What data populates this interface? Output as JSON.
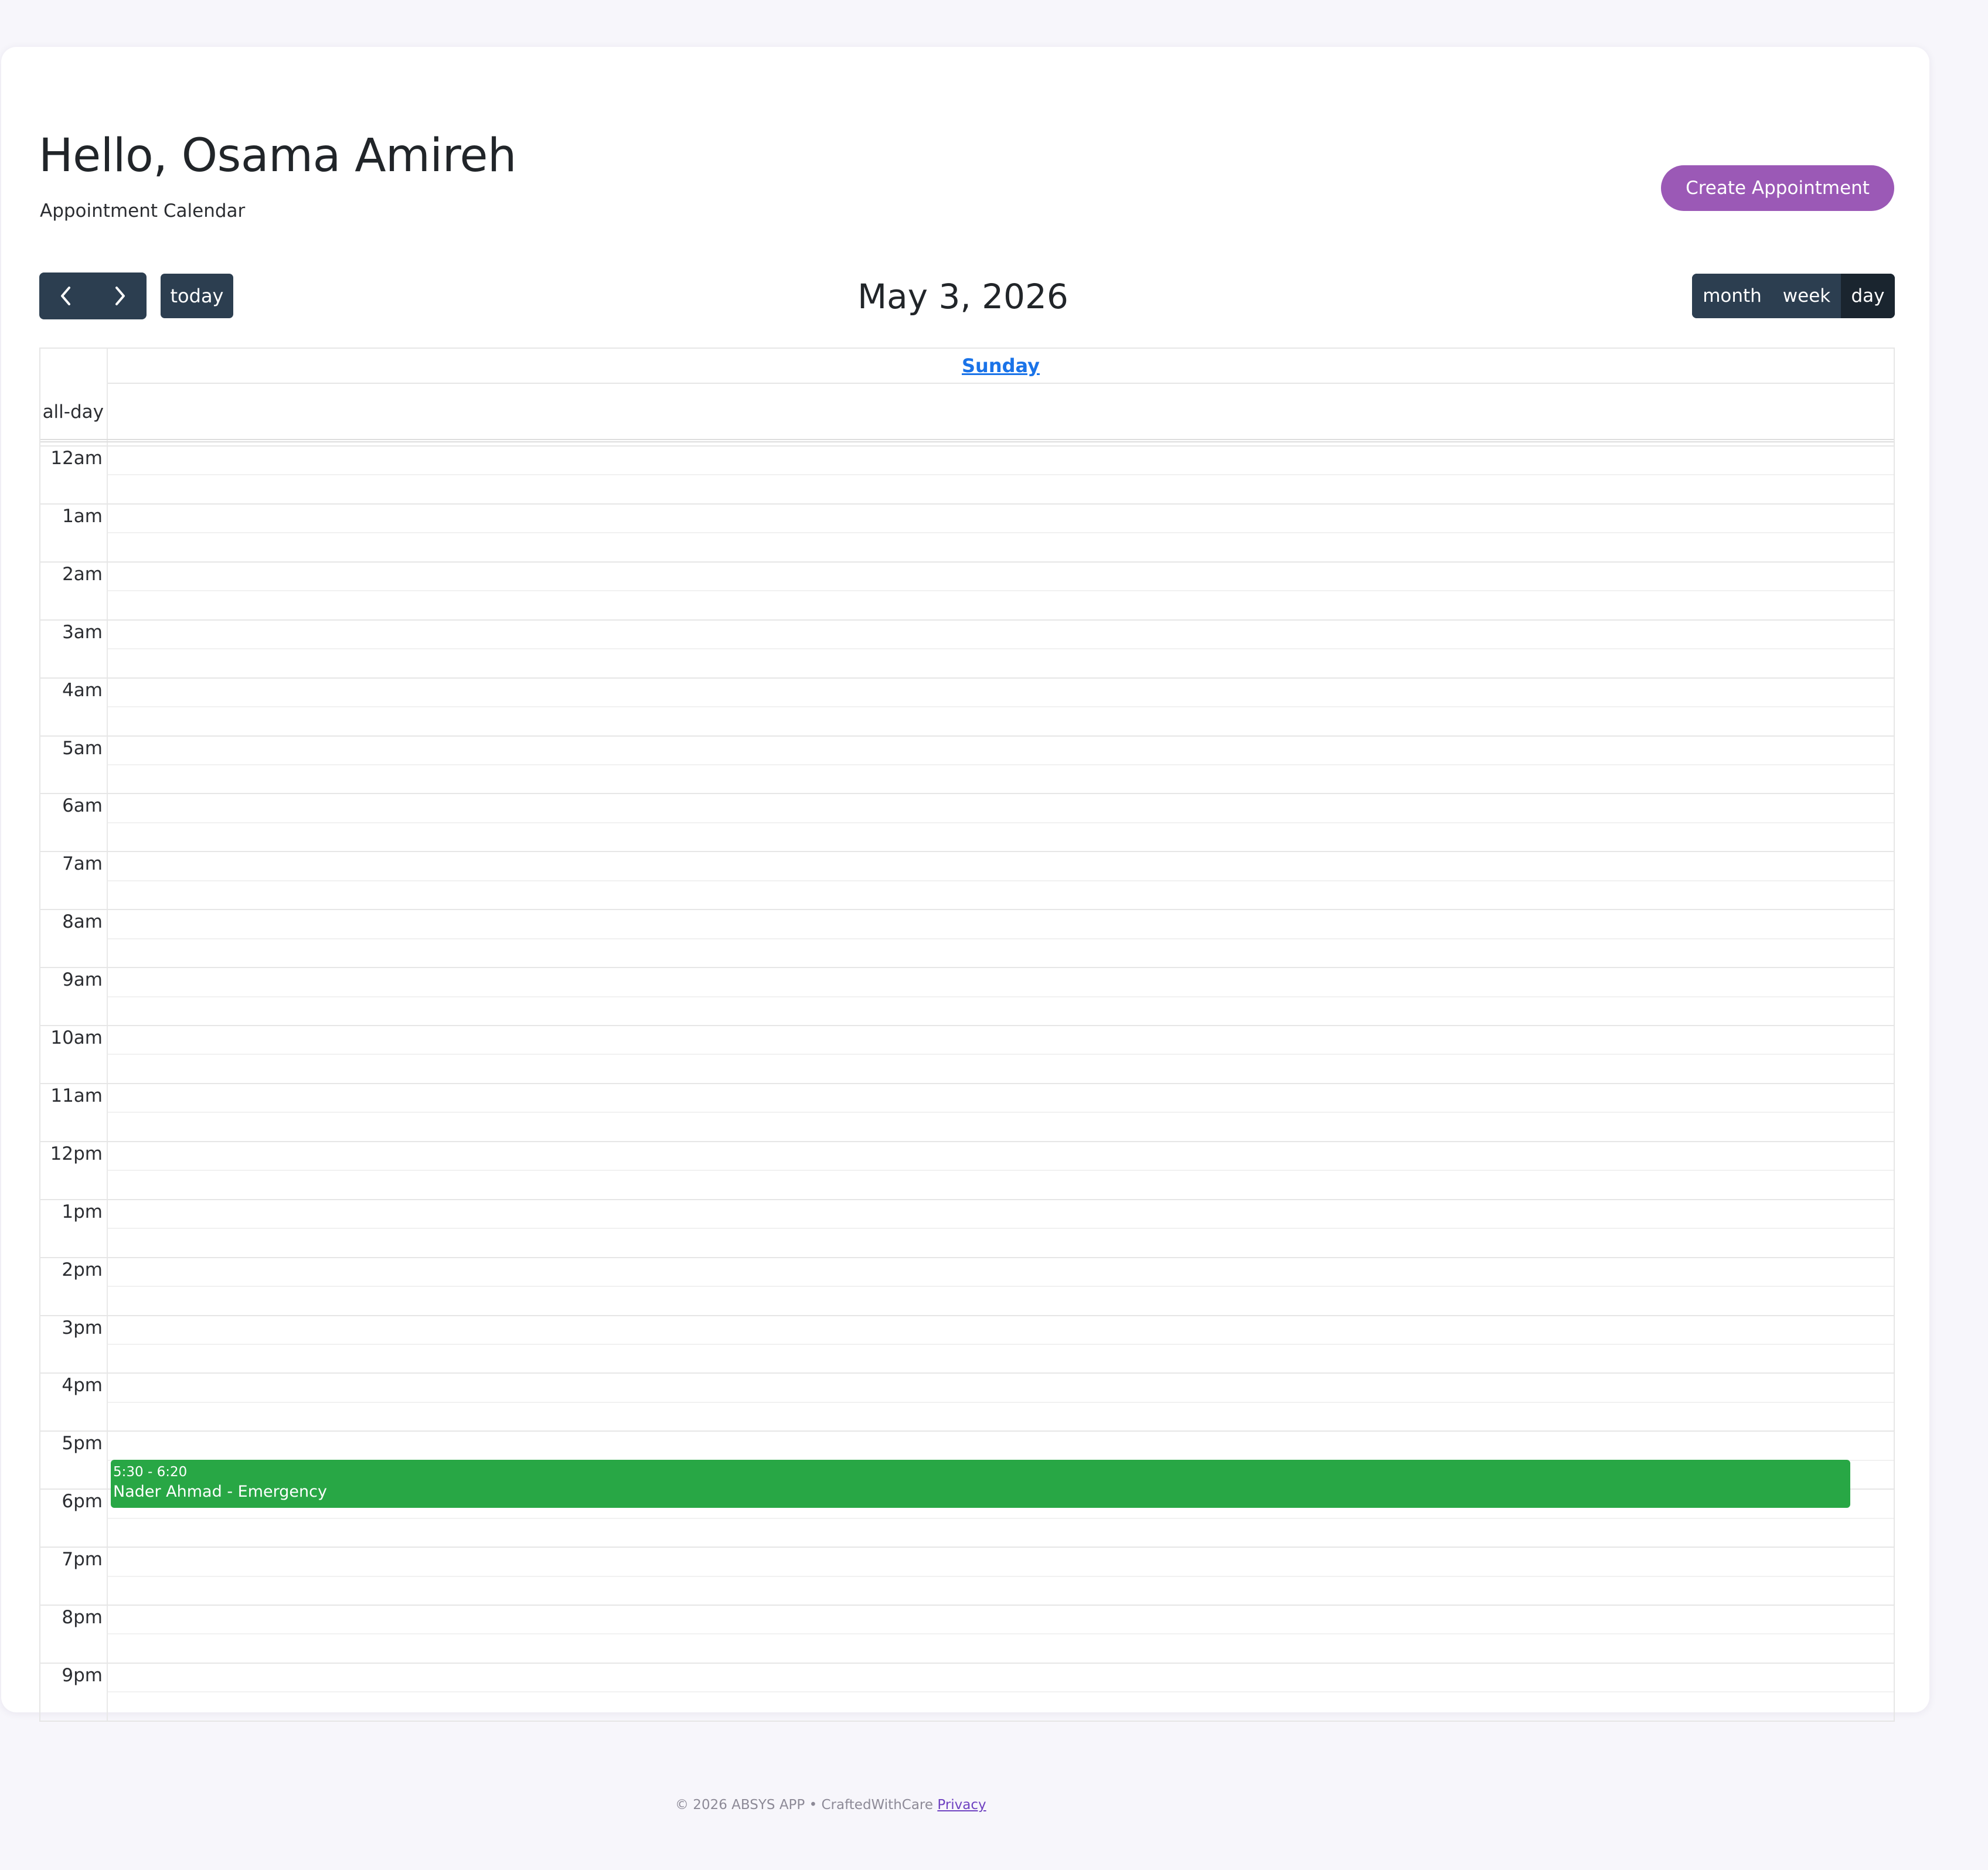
{
  "header": {
    "greeting": "Hello, Osama Amireh",
    "subtitle": "Appointment Calendar",
    "create_button": "Create Appointment"
  },
  "toolbar": {
    "prev_icon": "chevron-left-icon",
    "next_icon": "chevron-right-icon",
    "today_label": "today",
    "title": "May 3, 2026",
    "views": [
      "month",
      "week",
      "day"
    ],
    "active_view": "day"
  },
  "calendar": {
    "day_header": "Sunday",
    "allday_label": "all-day",
    "hours": [
      "12am",
      "1am",
      "2am",
      "3am",
      "4am",
      "5am",
      "6am",
      "7am",
      "8am",
      "9am",
      "10am",
      "11am",
      "12pm",
      "1pm",
      "2pm",
      "3pm",
      "4pm",
      "5pm",
      "6pm",
      "7pm",
      "8pm",
      "9pm"
    ],
    "events": [
      {
        "time": "5:30 - 6:20",
        "title": "Nader Ahmad - Emergency",
        "start_hour": 17.5,
        "end_hour": 18.333,
        "color": "#28a745"
      }
    ]
  },
  "footer": {
    "text": "© 2026 ABSYS APP • CraftedWithCare",
    "link": "Privacy"
  },
  "colors": {
    "accent": "#9b59b6",
    "toolbar": "#2c3e50",
    "toolbar_active": "#1a252f",
    "link": "#1a73e8",
    "event": "#28a745"
  }
}
